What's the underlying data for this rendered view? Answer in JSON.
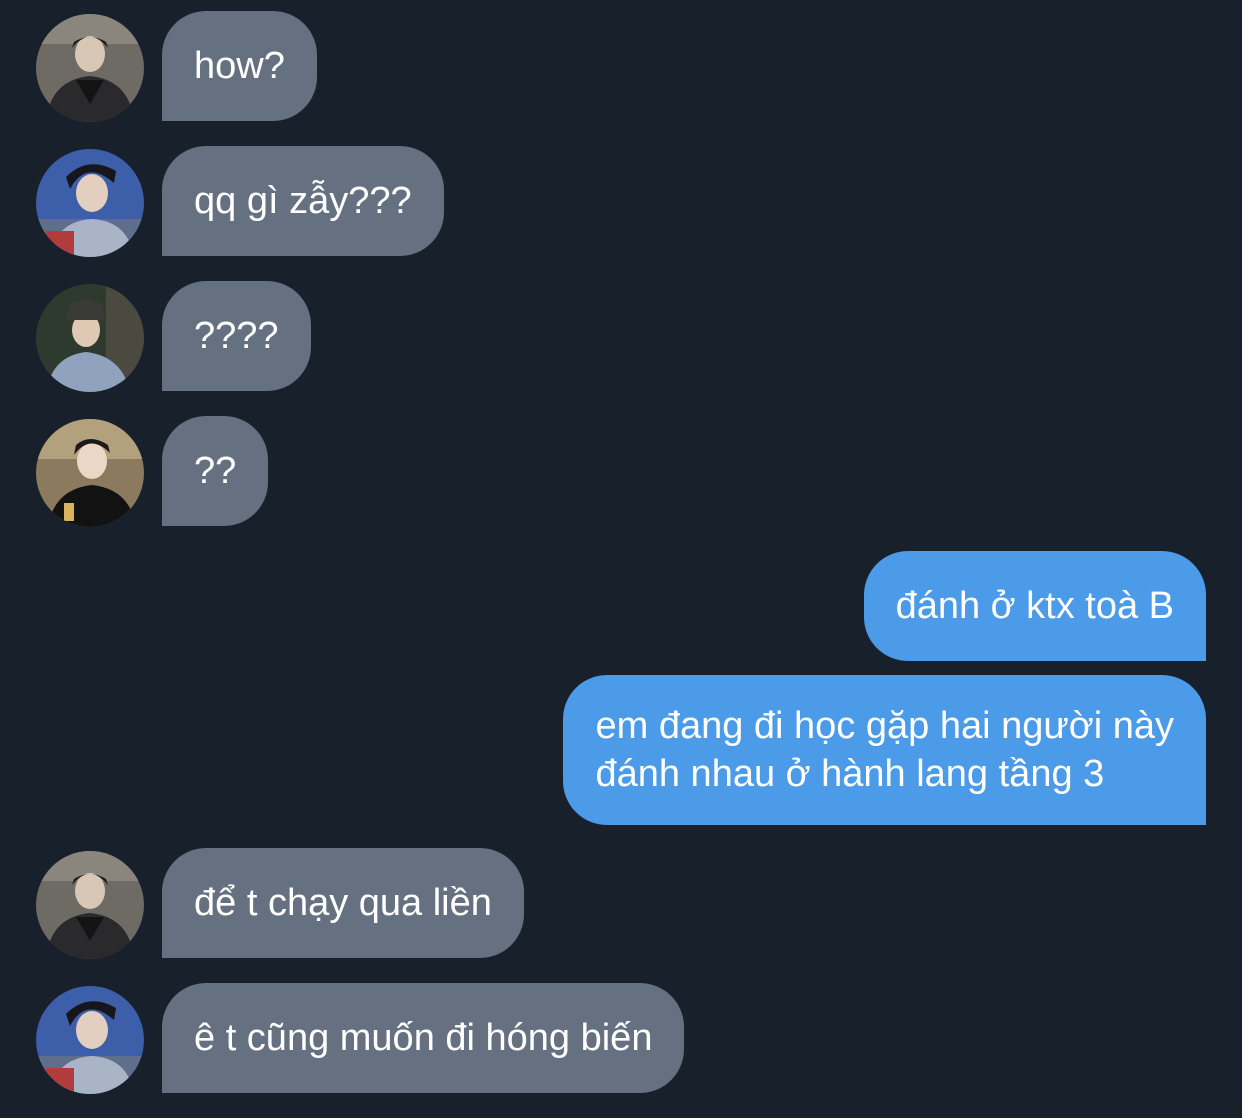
{
  "conversation": {
    "messages": [
      {
        "sender": "avatar-1",
        "direction": "incoming",
        "text": "how?"
      },
      {
        "sender": "avatar-2",
        "direction": "incoming",
        "text": "qq gì zẫy???"
      },
      {
        "sender": "avatar-3",
        "direction": "incoming",
        "text": "????"
      },
      {
        "sender": "avatar-4",
        "direction": "incoming",
        "text": "??"
      },
      {
        "sender": "me",
        "direction": "outgoing",
        "text": "đánh ở ktx toà B"
      },
      {
        "sender": "me",
        "direction": "outgoing",
        "lines": [
          "em đang đi học gặp hai người này",
          "đánh nhau ở hành lang tầng 3"
        ]
      },
      {
        "sender": "avatar-1",
        "direction": "incoming",
        "text": "để t chạy qua liền"
      },
      {
        "sender": "avatar-2",
        "direction": "incoming",
        "text": "ê t cũng muốn đi hóng biến"
      }
    ]
  },
  "colors": {
    "background": "#18202b",
    "incoming_bubble": "#657180",
    "outgoing_bubble": "#4c9be8",
    "text": "#ffffff"
  }
}
